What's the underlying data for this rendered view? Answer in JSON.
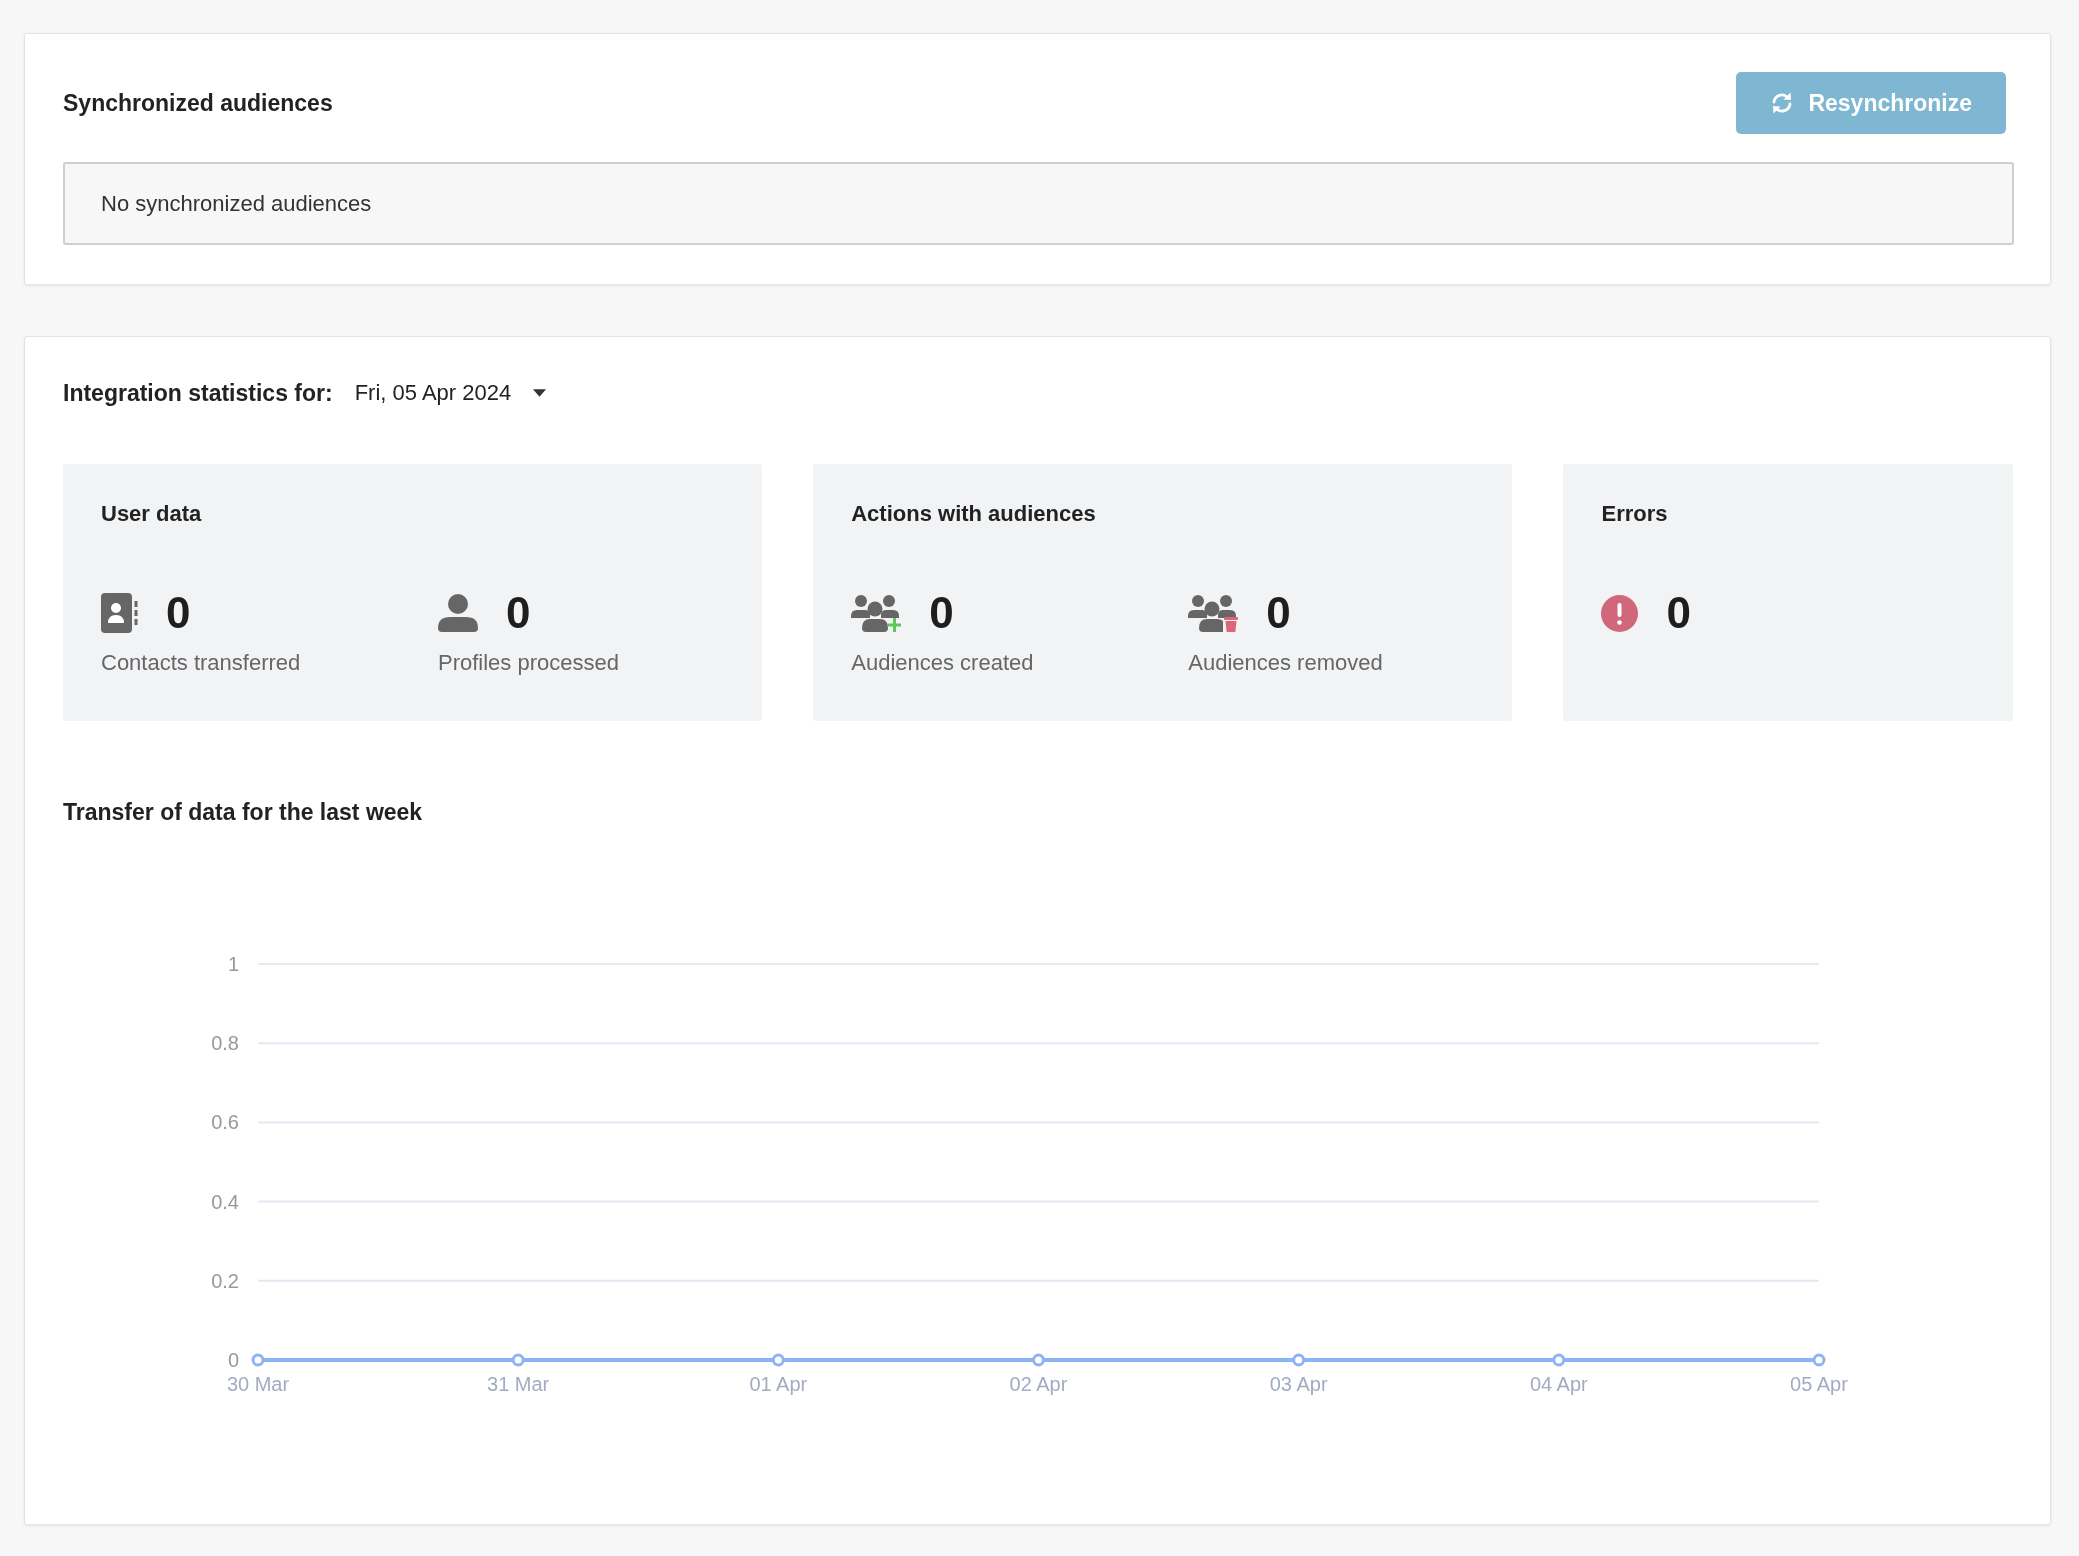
{
  "sync_section": {
    "title": "Synchronized audiences",
    "resync_button": {
      "label": "Resynchronize",
      "disabled": true
    },
    "empty_message": "No synchronized audiences"
  },
  "statistics": {
    "label": "Integration statistics for:",
    "date": "Fri, 05 Apr 2024",
    "groups": [
      {
        "title": "User data",
        "stats": [
          {
            "kind": "contacts",
            "value": "0",
            "label": "Contacts transferred"
          },
          {
            "kind": "person",
            "value": "0",
            "label": "Profiles processed"
          }
        ]
      },
      {
        "title": "Actions with audiences",
        "stats": [
          {
            "kind": "groupadd",
            "value": "0",
            "label": "Audiences created"
          },
          {
            "kind": "groupremove",
            "value": "0",
            "label": "Audiences removed"
          }
        ]
      },
      {
        "title": "Errors",
        "stats": [
          {
            "kind": "error",
            "value": "0"
          }
        ]
      }
    ]
  },
  "chart_section": {
    "title": "Transfer of data for the last week",
    "chart_data": {
      "type": "line",
      "categories": [
        "30 Mar",
        "31 Mar",
        "01 Apr",
        "02 Apr",
        "03 Apr",
        "04 Apr",
        "05 Apr"
      ],
      "series": [
        {
          "color": "#8fb3f2",
          "marker": "circle",
          "values": [
            0,
            0,
            0,
            0,
            0,
            0,
            0
          ]
        }
      ],
      "ylim": [
        0,
        1
      ],
      "yticks": [
        0,
        0.2,
        0.4,
        0.6,
        0.8,
        1
      ],
      "grid": true
    }
  }
}
